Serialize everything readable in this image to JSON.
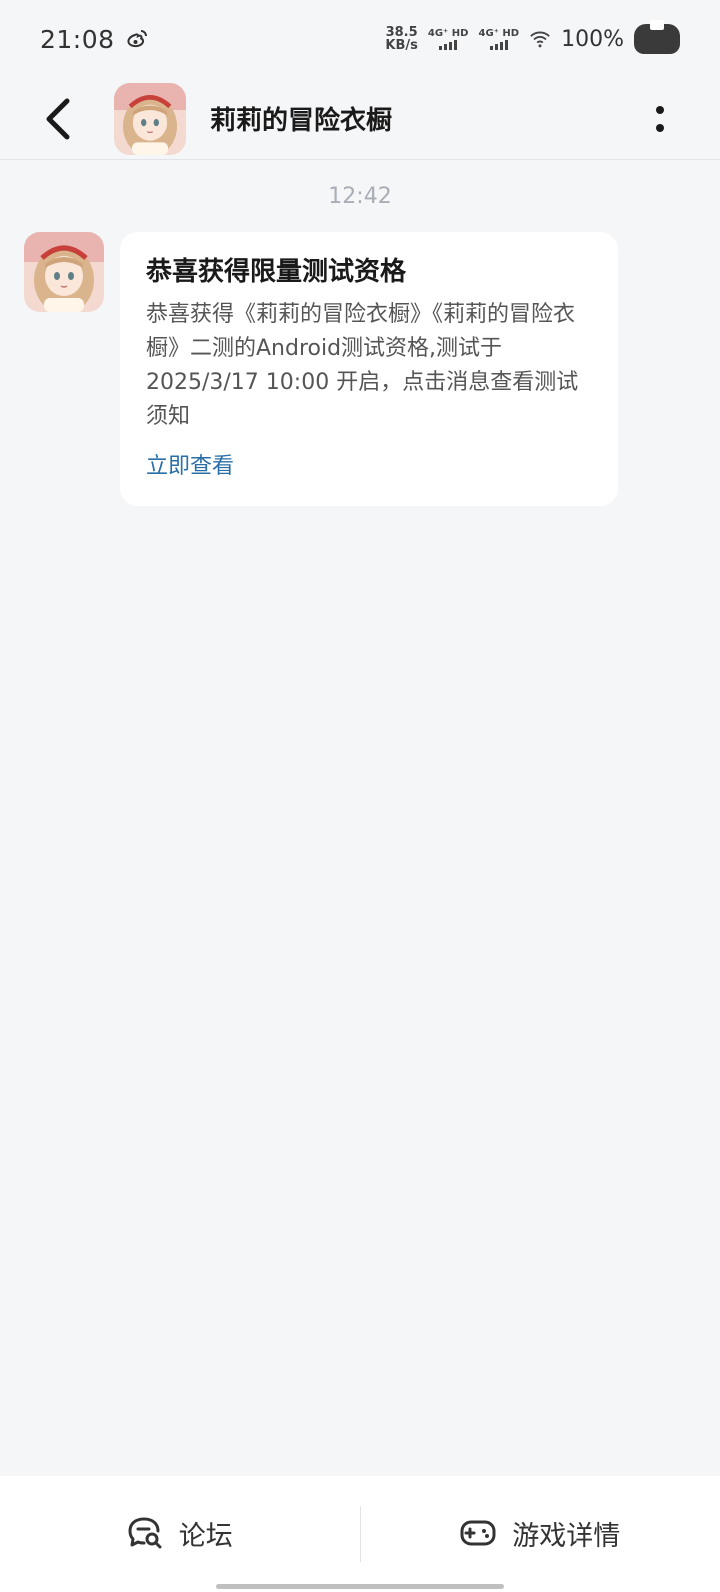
{
  "status_bar": {
    "time": "21:08",
    "speed_value": "38.5",
    "speed_unit": "KB/s",
    "sim1": "4G⁺ HD",
    "sim2": "4G⁺ HD",
    "battery": "100%",
    "icons": [
      "weibo-icon",
      "signal-icon",
      "wifi-icon",
      "battery-icon"
    ]
  },
  "header": {
    "title": "莉莉的冒险衣橱",
    "icons": [
      "back-arrow-icon",
      "more-vertical-icon"
    ]
  },
  "chat": {
    "timestamp": "12:42",
    "message": {
      "title": "恭喜获得限量测试资格",
      "body": "恭喜获得《莉莉的冒险衣橱》《莉莉的冒险衣橱》二测的Android测试资格,测试于2025/3/17 10:00 开启，点击消息查看测试须知",
      "link": "立即查看"
    }
  },
  "bottom_bar": {
    "forum_label": "论坛",
    "game_detail_label": "游戏详情",
    "icons": [
      "forum-chat-icon",
      "gamepad-icon"
    ]
  },
  "colors": {
    "background": "#f5f6f8",
    "bubble": "#ffffff",
    "link": "#2a6fa8",
    "timestamp": "#a9adb4"
  }
}
